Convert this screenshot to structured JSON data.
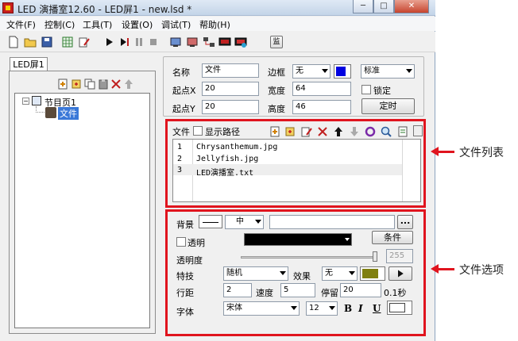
{
  "window": {
    "title": "LED 演播室12.60 - LED屏1 - new.lsd *",
    "min": "─",
    "max": "□",
    "close": "✕"
  },
  "menu": [
    "文件(F)",
    "控制(C)",
    "工具(T)",
    "设置(O)",
    "调试(T)",
    "帮助(H)"
  ],
  "toolbar": {
    "monitor_label": "监"
  },
  "left": {
    "tab": "LED屏1",
    "tree_root": "节目页1",
    "tree_child": "文件"
  },
  "props": {
    "name_label": "名称",
    "name_value": "文件",
    "border_label": "边框",
    "border_value": "无",
    "standard_value": "标准",
    "x_label": "起点X",
    "x_value": "20",
    "width_label": "宽度",
    "width_value": "64",
    "lock_label": "锁定",
    "y_label": "起点Y",
    "y_value": "20",
    "height_label": "高度",
    "height_value": "46",
    "timer_button": "定时"
  },
  "file_list": {
    "label": "文件",
    "show_path": "显示路径",
    "rows": [
      {
        "index": "1",
        "name": "Chrysanthemum.jpg"
      },
      {
        "index": "2",
        "name": "Jellyfish.jpg"
      },
      {
        "index": "3",
        "name": "LED演播室.txt"
      }
    ]
  },
  "options": {
    "bg_label": "背景",
    "align_value": "中",
    "browse": "...",
    "transparent_label": "透明",
    "condition_button": "条件",
    "opacity_label": "透明度",
    "opacity_value": "255",
    "effect_label": "特技",
    "effect_value": "随机",
    "effect2_label": "效果",
    "effect2_value": "无",
    "line_label": "行距",
    "line_value": "2",
    "speed_label": "速度",
    "speed_value": "5",
    "stay_label": "停留",
    "stay_value": "20",
    "unit": "0.1秒",
    "font_label": "字体",
    "font_value": "宋体",
    "size_value": "12",
    "bold": "B",
    "italic": "I",
    "underline": "U"
  },
  "annotations": {
    "file_list": "文件列表",
    "file_options": "文件选项"
  },
  "colors": {
    "highlight_red": "#e0141e",
    "border_color_swatch": "#0000e0",
    "effect_color_swatch": "#7f7f10"
  }
}
